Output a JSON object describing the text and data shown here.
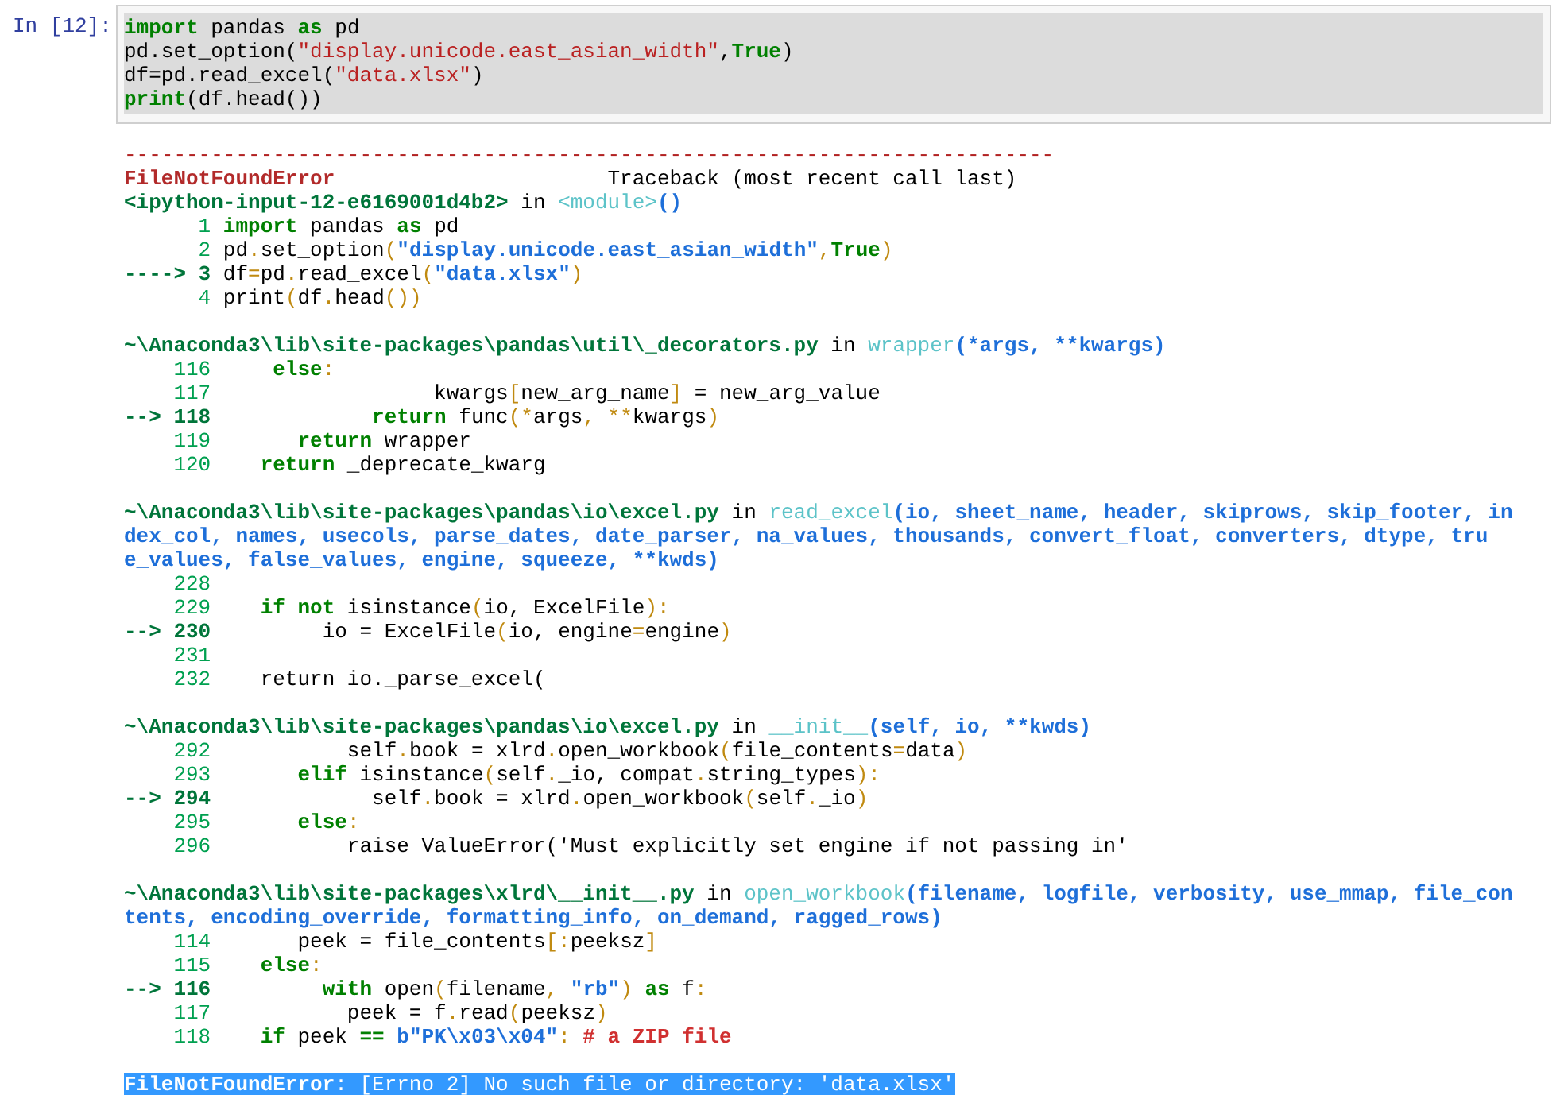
{
  "cell": {
    "prompt": "In [12]:",
    "input_lines": [
      [
        {
          "kind": "kw",
          "text": "import"
        },
        {
          "kind": "plain",
          "text": " pandas "
        },
        {
          "kind": "kw",
          "text": "as"
        },
        {
          "kind": "plain",
          "text": " pd"
        }
      ],
      [
        {
          "kind": "plain",
          "text": "pd.set_option("
        },
        {
          "kind": "str",
          "text": "\"display.unicode.east_asian_width\""
        },
        {
          "kind": "plain",
          "text": ","
        },
        {
          "kind": "kw",
          "text": "True"
        },
        {
          "kind": "plain",
          "text": ")"
        }
      ],
      [
        {
          "kind": "plain",
          "text": "df=pd.read_excel("
        },
        {
          "kind": "str",
          "text": "\"data.xlsx\""
        },
        {
          "kind": "plain",
          "text": ")"
        }
      ],
      [
        {
          "kind": "kw",
          "text": "print"
        },
        {
          "kind": "plain",
          "text": "(df.head())"
        }
      ]
    ],
    "output_lines": [
      {
        "kind": "code",
        "selected": false,
        "parts": [
          {
            "kind": "dash",
            "text": "---------------------------------------------------------------------------"
          }
        ]
      },
      {
        "kind": "code",
        "selected": false,
        "parts": [
          {
            "kind": "err",
            "text": "FileNotFoundError"
          },
          {
            "kind": "plain",
            "text": "                      Traceback (most recent call last)"
          }
        ]
      },
      {
        "kind": "code",
        "selected": false,
        "parts": [
          {
            "kind": "path",
            "text": "<ipython-input-12-e6169001d4b2>"
          },
          {
            "kind": "plain",
            "text": " in "
          },
          {
            "kind": "fn",
            "text": "<module>"
          },
          {
            "kind": "args",
            "text": "()"
          }
        ]
      },
      {
        "kind": "code",
        "selected": false,
        "parts": [
          {
            "kind": "lineno",
            "text": "      1 "
          },
          {
            "kind": "kw",
            "text": "import"
          },
          {
            "kind": "plain",
            "text": " pandas "
          },
          {
            "kind": "kw",
            "text": "as"
          },
          {
            "kind": "plain",
            "text": " pd"
          }
        ]
      },
      {
        "kind": "code",
        "selected": false,
        "parts": [
          {
            "kind": "lineno",
            "text": "      2 "
          },
          {
            "kind": "plain",
            "text": "pd"
          },
          {
            "kind": "paren",
            "text": "."
          },
          {
            "kind": "plain",
            "text": "set_option"
          },
          {
            "kind": "paren",
            "text": "("
          },
          {
            "kind": "args",
            "text": "\"display.unicode.east_asian_width\""
          },
          {
            "kind": "paren",
            "text": ","
          },
          {
            "kind": "kw",
            "text": "True"
          },
          {
            "kind": "paren",
            "text": ")"
          }
        ]
      },
      {
        "kind": "code",
        "selected": false,
        "parts": [
          {
            "kind": "arrow",
            "text": "----> 3 "
          },
          {
            "kind": "plain",
            "text": "df"
          },
          {
            "kind": "paren",
            "text": "="
          },
          {
            "kind": "plain",
            "text": "pd"
          },
          {
            "kind": "paren",
            "text": "."
          },
          {
            "kind": "plain",
            "text": "read_excel"
          },
          {
            "kind": "paren",
            "text": "("
          },
          {
            "kind": "args",
            "text": "\"data.xlsx\""
          },
          {
            "kind": "paren",
            "text": ")"
          }
        ]
      },
      {
        "kind": "code",
        "selected": false,
        "parts": [
          {
            "kind": "lineno",
            "text": "      4 "
          },
          {
            "kind": "plain",
            "text": "print"
          },
          {
            "kind": "paren",
            "text": "("
          },
          {
            "kind": "plain",
            "text": "df"
          },
          {
            "kind": "paren",
            "text": "."
          },
          {
            "kind": "plain",
            "text": "head"
          },
          {
            "kind": "paren",
            "text": "())"
          }
        ]
      },
      {
        "kind": "blank"
      },
      {
        "kind": "code",
        "selected": false,
        "parts": [
          {
            "kind": "path",
            "text": "~\\Anaconda3\\lib\\site-packages\\pandas\\util\\_decorators.py"
          },
          {
            "kind": "plain",
            "text": " in "
          },
          {
            "kind": "fn",
            "text": "wrapper"
          },
          {
            "kind": "args",
            "text": "(*args, **kwargs)"
          }
        ]
      },
      {
        "kind": "code",
        "selected": false,
        "parts": [
          {
            "kind": "lineno",
            "text": "    116"
          },
          {
            "kind": "kw",
            "text": "     else"
          },
          {
            "kind": "paren",
            "text": ":"
          }
        ]
      },
      {
        "kind": "code",
        "selected": false,
        "parts": [
          {
            "kind": "lineno",
            "text": "    117"
          },
          {
            "kind": "plain",
            "text": "                  kwargs"
          },
          {
            "kind": "paren",
            "text": "["
          },
          {
            "kind": "plain",
            "text": "new_arg_name"
          },
          {
            "kind": "paren",
            "text": "]"
          },
          {
            "kind": "plain",
            "text": " = new_arg_value"
          }
        ]
      },
      {
        "kind": "code",
        "selected": false,
        "parts": [
          {
            "kind": "arrow",
            "text": "--> 118"
          },
          {
            "kind": "kw",
            "text": "             return"
          },
          {
            "kind": "plain",
            "text": " func"
          },
          {
            "kind": "paren",
            "text": "(*"
          },
          {
            "kind": "plain",
            "text": "args"
          },
          {
            "kind": "paren",
            "text": ", **"
          },
          {
            "kind": "plain",
            "text": "kwargs"
          },
          {
            "kind": "paren",
            "text": ")"
          }
        ]
      },
      {
        "kind": "code",
        "selected": false,
        "parts": [
          {
            "kind": "lineno",
            "text": "    119"
          },
          {
            "kind": "kw",
            "text": "       return"
          },
          {
            "kind": "plain",
            "text": " wrapper"
          }
        ]
      },
      {
        "kind": "code",
        "selected": false,
        "parts": [
          {
            "kind": "lineno",
            "text": "    120"
          },
          {
            "kind": "kw",
            "text": "    return"
          },
          {
            "kind": "plain",
            "text": " _deprecate_kwarg"
          }
        ]
      },
      {
        "kind": "blank"
      },
      {
        "kind": "code",
        "selected": false,
        "parts": [
          {
            "kind": "path",
            "text": "~\\Anaconda3\\lib\\site-packages\\pandas\\io\\excel.py"
          },
          {
            "kind": "plain",
            "text": " in "
          },
          {
            "kind": "fn",
            "text": "read_excel"
          },
          {
            "kind": "args",
            "text": "(io, sheet_name, header, skiprows, skip_footer, in"
          }
        ]
      },
      {
        "kind": "code",
        "selected": false,
        "parts": [
          {
            "kind": "args",
            "text": "dex_col, names, usecols, parse_dates, date_parser, na_values, thousands, convert_float, converters, dtype, tru"
          }
        ]
      },
      {
        "kind": "code",
        "selected": false,
        "parts": [
          {
            "kind": "args",
            "text": "e_values, false_values, engine, squeeze, **kwds)"
          }
        ]
      },
      {
        "kind": "code",
        "selected": false,
        "parts": [
          {
            "kind": "lineno",
            "text": "    228"
          }
        ]
      },
      {
        "kind": "code",
        "selected": false,
        "parts": [
          {
            "kind": "lineno",
            "text": "    229"
          },
          {
            "kind": "kw",
            "text": "    if not"
          },
          {
            "kind": "plain",
            "text": " isinstance"
          },
          {
            "kind": "paren",
            "text": "("
          },
          {
            "kind": "plain",
            "text": "io, ExcelFile"
          },
          {
            "kind": "paren",
            "text": "):"
          }
        ]
      },
      {
        "kind": "code",
        "selected": false,
        "parts": [
          {
            "kind": "arrow",
            "text": "--> 230"
          },
          {
            "kind": "plain",
            "text": "         io = ExcelFile"
          },
          {
            "kind": "paren",
            "text": "("
          },
          {
            "kind": "plain",
            "text": "io, engine"
          },
          {
            "kind": "paren",
            "text": "="
          },
          {
            "kind": "plain",
            "text": "engine"
          },
          {
            "kind": "paren",
            "text": ")"
          }
        ]
      },
      {
        "kind": "code",
        "selected": false,
        "parts": [
          {
            "kind": "lineno",
            "text": "    231"
          }
        ]
      },
      {
        "kind": "code",
        "selected": false,
        "parts": [
          {
            "kind": "lineno",
            "text": "    232"
          },
          {
            "kind": "plain",
            "text": "    return io._parse_excel("
          }
        ]
      },
      {
        "kind": "blank"
      },
      {
        "kind": "code",
        "selected": false,
        "parts": [
          {
            "kind": "path",
            "text": "~\\Anaconda3\\lib\\site-packages\\pandas\\io\\excel.py"
          },
          {
            "kind": "plain",
            "text": " in "
          },
          {
            "kind": "fn",
            "text": "__init__"
          },
          {
            "kind": "args",
            "text": "(self, io, **kwds)"
          }
        ]
      },
      {
        "kind": "code",
        "selected": false,
        "parts": [
          {
            "kind": "lineno",
            "text": "    292"
          },
          {
            "kind": "plain",
            "text": "           self"
          },
          {
            "kind": "paren",
            "text": "."
          },
          {
            "kind": "plain",
            "text": "book = xlrd"
          },
          {
            "kind": "paren",
            "text": "."
          },
          {
            "kind": "plain",
            "text": "open_workbook"
          },
          {
            "kind": "paren",
            "text": "("
          },
          {
            "kind": "plain",
            "text": "file_contents"
          },
          {
            "kind": "paren",
            "text": "="
          },
          {
            "kind": "plain",
            "text": "data"
          },
          {
            "kind": "paren",
            "text": ")"
          }
        ]
      },
      {
        "kind": "code",
        "selected": false,
        "parts": [
          {
            "kind": "lineno",
            "text": "    293"
          },
          {
            "kind": "kw",
            "text": "       elif"
          },
          {
            "kind": "plain",
            "text": " isinstance"
          },
          {
            "kind": "paren",
            "text": "("
          },
          {
            "kind": "plain",
            "text": "self"
          },
          {
            "kind": "paren",
            "text": "."
          },
          {
            "kind": "plain",
            "text": "_io, compat"
          },
          {
            "kind": "paren",
            "text": "."
          },
          {
            "kind": "plain",
            "text": "string_types"
          },
          {
            "kind": "paren",
            "text": "):"
          }
        ]
      },
      {
        "kind": "code",
        "selected": false,
        "parts": [
          {
            "kind": "arrow",
            "text": "--> 294"
          },
          {
            "kind": "plain",
            "text": "             self"
          },
          {
            "kind": "paren",
            "text": "."
          },
          {
            "kind": "plain",
            "text": "book = xlrd"
          },
          {
            "kind": "paren",
            "text": "."
          },
          {
            "kind": "plain",
            "text": "open_workbook"
          },
          {
            "kind": "paren",
            "text": "("
          },
          {
            "kind": "plain",
            "text": "self"
          },
          {
            "kind": "paren",
            "text": "."
          },
          {
            "kind": "plain",
            "text": "_io"
          },
          {
            "kind": "paren",
            "text": ")"
          }
        ]
      },
      {
        "kind": "code",
        "selected": false,
        "parts": [
          {
            "kind": "lineno",
            "text": "    295"
          },
          {
            "kind": "kw",
            "text": "       else"
          },
          {
            "kind": "paren",
            "text": ":"
          }
        ]
      },
      {
        "kind": "code",
        "selected": false,
        "parts": [
          {
            "kind": "lineno",
            "text": "    296"
          },
          {
            "kind": "plain",
            "text": "           raise ValueError('Must explicitly set engine if not passing in'"
          }
        ]
      },
      {
        "kind": "blank"
      },
      {
        "kind": "code",
        "selected": false,
        "parts": [
          {
            "kind": "path",
            "text": "~\\Anaconda3\\lib\\site-packages\\xlrd\\__init__.py"
          },
          {
            "kind": "plain",
            "text": " in "
          },
          {
            "kind": "fn",
            "text": "open_workbook"
          },
          {
            "kind": "args",
            "text": "(filename, logfile, verbosity, use_mmap, file_con"
          }
        ]
      },
      {
        "kind": "code",
        "selected": false,
        "parts": [
          {
            "kind": "args",
            "text": "tents, encoding_override, formatting_info, on_demand, ragged_rows)"
          }
        ]
      },
      {
        "kind": "code",
        "selected": false,
        "parts": [
          {
            "kind": "lineno",
            "text": "    114"
          },
          {
            "kind": "plain",
            "text": "       peek = file_contents"
          },
          {
            "kind": "paren",
            "text": "[:"
          },
          {
            "kind": "plain",
            "text": "peeksz"
          },
          {
            "kind": "paren",
            "text": "]"
          }
        ]
      },
      {
        "kind": "code",
        "selected": false,
        "parts": [
          {
            "kind": "lineno",
            "text": "    115"
          },
          {
            "kind": "kw",
            "text": "    else"
          },
          {
            "kind": "paren",
            "text": ":"
          }
        ]
      },
      {
        "kind": "code",
        "selected": false,
        "parts": [
          {
            "kind": "arrow",
            "text": "--> 116"
          },
          {
            "kind": "kw",
            "text": "         with"
          },
          {
            "kind": "plain",
            "text": " open"
          },
          {
            "kind": "paren",
            "text": "("
          },
          {
            "kind": "plain",
            "text": "filename"
          },
          {
            "kind": "paren",
            "text": ", "
          },
          {
            "kind": "args",
            "text": "\"rb\""
          },
          {
            "kind": "paren",
            "text": ")"
          },
          {
            "kind": "kw",
            "text": " as"
          },
          {
            "kind": "plain",
            "text": " f"
          },
          {
            "kind": "paren",
            "text": ":"
          }
        ]
      },
      {
        "kind": "code",
        "selected": false,
        "parts": [
          {
            "kind": "lineno",
            "text": "    117"
          },
          {
            "kind": "plain",
            "text": "           peek = f"
          },
          {
            "kind": "paren",
            "text": "."
          },
          {
            "kind": "plain",
            "text": "read"
          },
          {
            "kind": "paren",
            "text": "("
          },
          {
            "kind": "plain",
            "text": "peeksz"
          },
          {
            "kind": "paren",
            "text": ")"
          }
        ]
      },
      {
        "kind": "code",
        "selected": false,
        "parts": [
          {
            "kind": "lineno",
            "text": "    118"
          },
          {
            "kind": "kw",
            "text": "    if"
          },
          {
            "kind": "plain",
            "text": " peek "
          },
          {
            "kind": "kw",
            "text": "=="
          },
          {
            "kind": "args",
            "text": " b\"PK\\x03\\x04\""
          },
          {
            "kind": "paren",
            "text": ":"
          },
          {
            "kind": "comment",
            "text": " # a ZIP file"
          }
        ]
      },
      {
        "kind": "blank"
      },
      {
        "kind": "code",
        "selected": true,
        "parts": [
          {
            "kind": "err",
            "text": "FileNotFoundError"
          },
          {
            "kind": "plain",
            "text": ": [Errno 2] No such file or directory: 'data.xlsx'"
          }
        ]
      }
    ]
  }
}
